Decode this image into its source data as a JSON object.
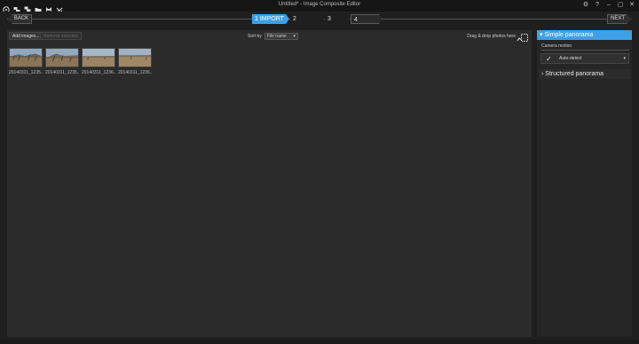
{
  "window": {
    "title": "Untitled* - Image Composite Editor"
  },
  "nav": {
    "back": "BACK",
    "next": "NEXT",
    "steps": [
      "1 IMPORT",
      "2 STITCH",
      "3 CROP",
      "4 EXPORT"
    ]
  },
  "toolbar": {
    "add": "Add images...",
    "remove": "Remove selected",
    "sort_label": "Sort by",
    "sort_value": "File name",
    "drop_hint": "Drag & drop photos here"
  },
  "thumbnails": [
    {
      "caption": "20140311_1235..."
    },
    {
      "caption": "20140311_1235..."
    },
    {
      "caption": "20140311_1236..."
    },
    {
      "caption": "20140311_1236..."
    }
  ],
  "side": {
    "simple": "Simple panorama",
    "camera_motion_label": "Camera motion",
    "camera_motion_value": "Auto-detect",
    "structured": "Structured panorama"
  },
  "colors": {
    "accent": "#3ea0e6",
    "panel": "#2b2b2b",
    "background": "#1f1f1f"
  }
}
